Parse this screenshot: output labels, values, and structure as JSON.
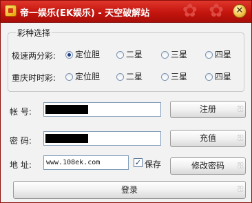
{
  "window": {
    "title": "帝一娱乐(EK娱乐) - 天空破解站",
    "close_glyph": "✕"
  },
  "lottery_group": {
    "legend": "彩种选择",
    "rows": [
      {
        "label": "极速两分彩:",
        "options": [
          {
            "label": "定位胆",
            "selected": true
          },
          {
            "label": "二星",
            "selected": false
          },
          {
            "label": "三星",
            "selected": false
          },
          {
            "label": "四星",
            "selected": false
          }
        ]
      },
      {
        "label": "重庆时时彩:",
        "options": [
          {
            "label": "定位胆",
            "selected": false
          },
          {
            "label": "二星",
            "selected": false
          },
          {
            "label": "三星",
            "selected": false
          },
          {
            "label": "四星",
            "selected": false
          }
        ]
      }
    ]
  },
  "form": {
    "account_label": "帐  号:",
    "password_label": "密  码:",
    "address_label": "地  址:",
    "address_value": "www.108ek.com",
    "save_label": "保存",
    "save_checked": true
  },
  "buttons": {
    "register": "注册",
    "recharge": "充值",
    "change_password": "修改密码",
    "login": "登录"
  },
  "colors": {
    "titlebar": "#c4150e",
    "window_bg": "#f2f2f2",
    "close_button": "#f2c24a"
  }
}
